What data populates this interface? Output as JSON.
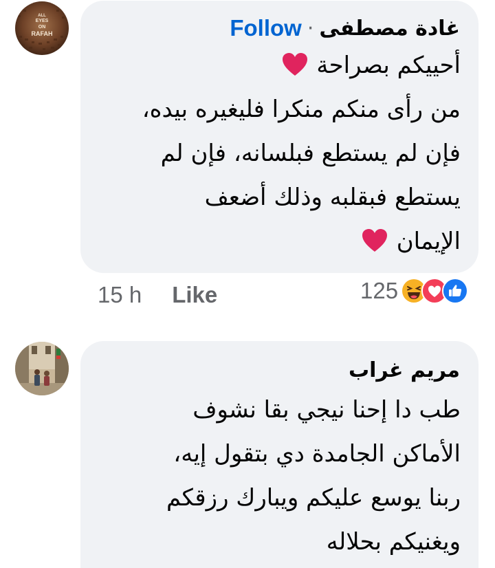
{
  "comments": [
    {
      "author": "غادة مصطفى",
      "separator": "·",
      "follow_label": "Follow",
      "avatar_text": "ALL EYES ON RAFAH",
      "lines": [
        "أحييكم بصراحة",
        "من رأى منكم منكرا فليغيره بيده،",
        "فإن لم يستطع فبلسانه، فإن لم",
        "يستطع فبقلبه وذلك أضعف",
        "الإيمان"
      ],
      "time": "15 h",
      "like_label": "Like",
      "reaction_count": "125",
      "reaction_icons": [
        "haha-reaction-icon",
        "love-reaction-icon",
        "like-reaction-icon"
      ]
    },
    {
      "author": "مريم غراب",
      "lines": [
        "طب دا إحنا نيجي بقا نشوف",
        "الأماكن الجامدة دي بتقول إيه،",
        "ربنا يوسع عليكم ويبارك رزقكم",
        "ويغنيكم بحلاله"
      ]
    }
  ],
  "colors": {
    "bubble": "#f0f2f5",
    "text": "#050505",
    "secondary": "#65676b",
    "follow": "#0064d1",
    "heart": "#e0245e",
    "love": "#f33e58",
    "like": "#1877f2",
    "haha": "#f7b125"
  }
}
